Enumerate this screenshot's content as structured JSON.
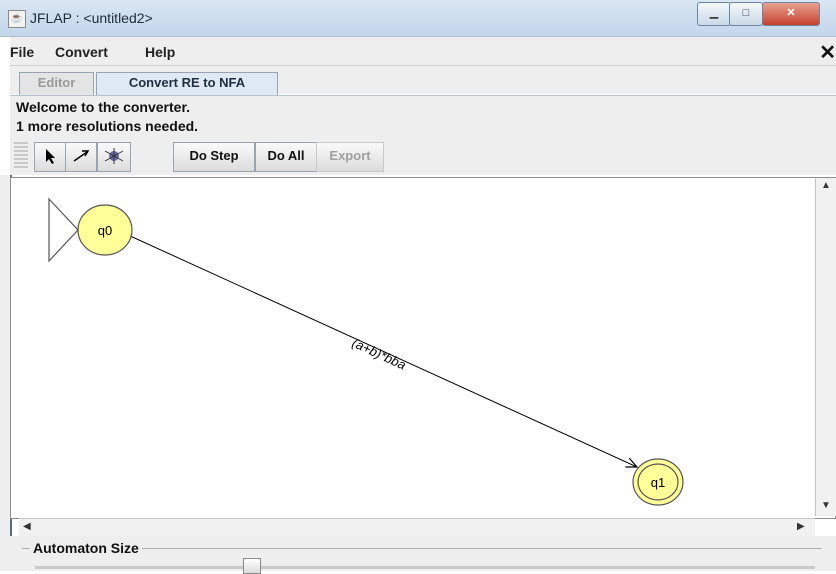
{
  "window": {
    "title": "JFLAP : <untitled2>",
    "min_glyph": "▁",
    "max_glyph": "□",
    "close_glyph": "✕"
  },
  "menu": {
    "items": [
      "File",
      "Convert",
      "Help"
    ],
    "close_glyph": "✕"
  },
  "tabs": [
    {
      "label": "Editor"
    },
    {
      "label": "Convert RE to NFA"
    }
  ],
  "messages": {
    "line1": "Welcome to the converter.",
    "line2": "1 more resolutions needed."
  },
  "toolbar": {
    "do_step": "Do Step",
    "do_all": "Do All",
    "export": "Export"
  },
  "automaton": {
    "states": [
      {
        "label": "q0",
        "initial": true,
        "final": false
      },
      {
        "label": "q1",
        "initial": false,
        "final": true
      }
    ],
    "transition_label": "(a+b)*bba"
  },
  "size_panel": {
    "label": "Automaton Size"
  },
  "colors": {
    "state_fill": "#ffff99",
    "state_stroke": "#555555"
  }
}
